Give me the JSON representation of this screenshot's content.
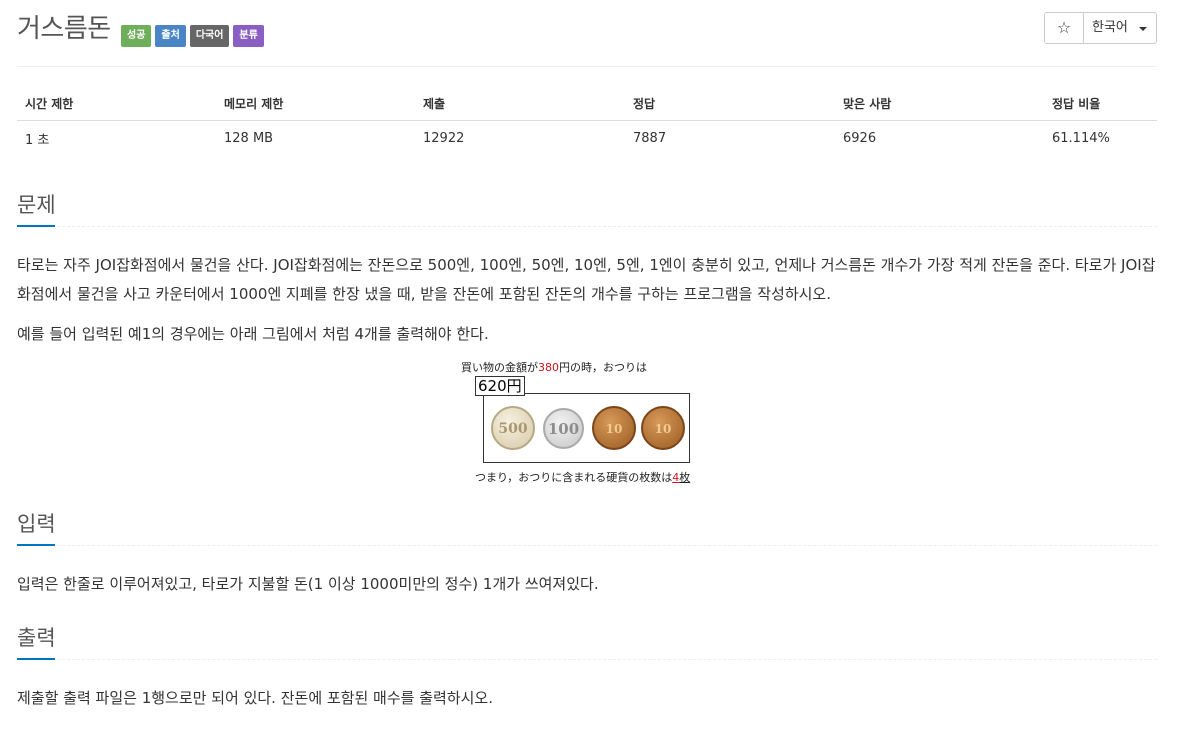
{
  "header": {
    "title": "거스름돈",
    "badges": [
      {
        "label": "성공",
        "color": "#6fae5a"
      },
      {
        "label": "출처",
        "color": "#4a86c5"
      },
      {
        "label": "다국어",
        "color": "#666666"
      },
      {
        "label": "분류",
        "color": "#8a5ec2"
      }
    ],
    "star_icon": "☆",
    "language": "한국어"
  },
  "stats": {
    "headers": [
      "시간 제한",
      "메모리 제한",
      "제출",
      "정답",
      "맞은 사람",
      "정답 비율"
    ],
    "values": [
      "1 초",
      "128 MB",
      "12922",
      "7887",
      "6926",
      "61.114%"
    ]
  },
  "sections": {
    "problem": {
      "title": "문제",
      "paragraph1": "타로는 자주 JOI잡화점에서 물건을 산다. JOI잡화점에는 잔돈으로 500엔, 100엔, 50엔, 10엔, 5엔, 1엔이 충분히 있고, 언제나 거스름돈 개수가 가장 적게 잔돈을 준다. 타로가 JOI잡화점에서 물건을 사고 카운터에서 1000엔 지폐를 한장 냈을 때, 받을 잔돈에 포함된 잔돈의 개수를 구하는 프로그램을 작성하시오.",
      "paragraph2": "예를 들어 입력된 예1의 경우에는 아래 그림에서 처럼 4개를 출력해야 한다."
    },
    "input": {
      "title": "입력",
      "text": "입력은 한줄로 이루어져있고, 타로가 지불할 돈(1 이상 1000미만의 정수) 1개가 쓰여져있다."
    },
    "output": {
      "title": "출력",
      "text": "제출할 출력 파일은 1행으로만 되어 있다. 잔돈에 포함된 매수를 출력하시오."
    }
  },
  "figure": {
    "top_prefix": "買い物の金額が",
    "top_amount": "380",
    "top_suffix": "円の時，おつりは",
    "change_amount": "620円",
    "coins": [
      "500",
      "100",
      "10",
      "10"
    ],
    "bottom_prefix": "つまり，おつりに含まれる硬貨の枚数は",
    "bottom_count": "4",
    "bottom_unit": "枚"
  }
}
